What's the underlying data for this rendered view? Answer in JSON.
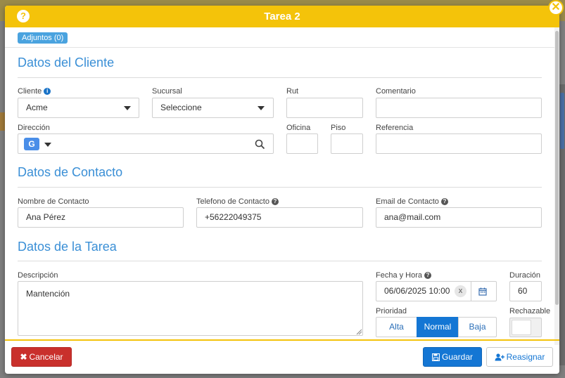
{
  "modal": {
    "title": "Tarea 2",
    "help_icon": "?",
    "close_icon": "✕",
    "attachments_label": "Adjuntos (0)"
  },
  "sections": {
    "client": "Datos del Cliente",
    "contact": "Datos de Contacto",
    "task": "Datos de la Tarea"
  },
  "client": {
    "client_label": "Cliente",
    "client_value": "Acme",
    "branch_label": "Sucursal",
    "branch_value": "Seleccione",
    "rut_label": "Rut",
    "rut_value": "",
    "comment_label": "Comentario",
    "comment_value": "",
    "address_label": "Dirección",
    "address_value": "",
    "address_provider_icon": "G",
    "office_label": "Oficina",
    "office_value": "",
    "floor_label": "Piso",
    "floor_value": "",
    "reference_label": "Referencia",
    "reference_value": ""
  },
  "contact": {
    "name_label": "Nombre de Contacto",
    "name_value": "Ana Pérez",
    "phone_label": "Telefono de Contacto",
    "phone_value": "+56222049375",
    "email_label": "Email de Contacto",
    "email_value": "ana@mail.com"
  },
  "task": {
    "description_label": "Descripción",
    "description_value": "Mantención",
    "datetime_label": "Fecha y Hora",
    "datetime_value": "06/06/2025 10:00",
    "clear_icon": "x",
    "duration_label": "Duración",
    "duration_value": "60",
    "priority_label": "Prioridad",
    "priority_options": [
      "Alta",
      "Normal",
      "Baja"
    ],
    "priority_selected": "Normal",
    "rejectable_label": "Rechazable"
  },
  "footer": {
    "cancel_label": "Cancelar",
    "save_label": "Guardar",
    "reassign_label": "Reasignar"
  },
  "colors": {
    "header": "#f4c30a",
    "accent_blue": "#1476d4",
    "section_blue": "#3a8fd6",
    "cancel_red": "#c9302c"
  }
}
